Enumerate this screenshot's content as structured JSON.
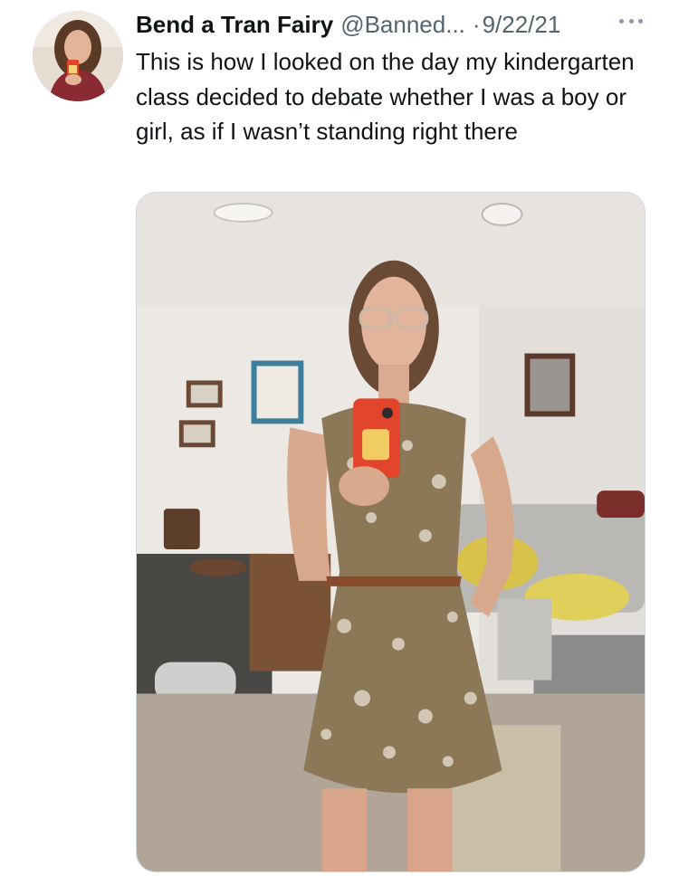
{
  "tweet": {
    "display_name": "Bend a Tran Fairy",
    "handle": "@Banned...",
    "separator": "·",
    "date": "9/22/21",
    "more_icon": "more-horizontal-icon",
    "text": "This is how I looked on the day my kindergarten class decided to debate whether I was a boy or girl, as if I wasn’t standing right there"
  },
  "media": {
    "kind": "photo",
    "alt_subject": "mirror selfie in floral dress"
  }
}
